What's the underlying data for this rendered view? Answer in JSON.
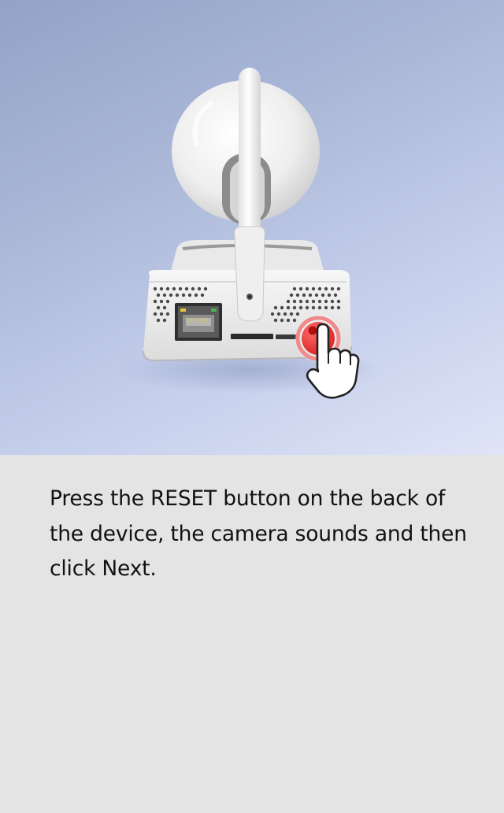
{
  "illustration": {
    "subject": "ip-camera-back",
    "icons": [
      "ethernet-port-icon",
      "sd-card-slot-icon",
      "reset-button-icon",
      "pointing-hand-icon"
    ],
    "highlight_color": "#e53935",
    "background_gradient": [
      "#93a2c8",
      "#dfe4f7"
    ]
  },
  "instruction": {
    "text": "Press the RESET button on the back of the device, the camera sounds and then click Next."
  }
}
